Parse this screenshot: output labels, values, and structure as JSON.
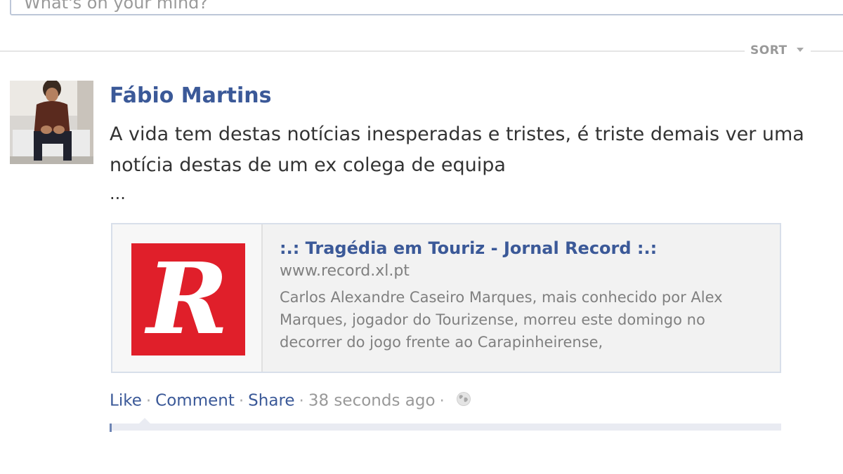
{
  "composer": {
    "placeholder": "What's on your mind?"
  },
  "feed": {
    "sort_label": "SORT"
  },
  "post": {
    "author": "Fábio Martins",
    "text": "A vida tem destas notícias inesperadas e tristes, é triste demais ver uma notícia destas de um ex colega de equipa",
    "more": "...",
    "link": {
      "title": ":.: Tragédia em Touriz - Jornal Record :.:",
      "url": "www.record.xl.pt",
      "description": "Carlos Alexandre Caseiro Marques, mais conhecido por Alex Marques, jogador do Tourizense, morreu este domingo no decorrer do jogo frente ao Carapinheirense,",
      "thumb_letter": "R",
      "thumb_color": "#e01f2a"
    },
    "actions": {
      "like": "Like",
      "comment": "Comment",
      "share": "Share",
      "timestamp": "38 seconds ago",
      "separator": "·"
    },
    "privacy_icon": "globe-icon"
  },
  "colors": {
    "link_blue": "#3b5998",
    "muted_gray": "#999999"
  }
}
